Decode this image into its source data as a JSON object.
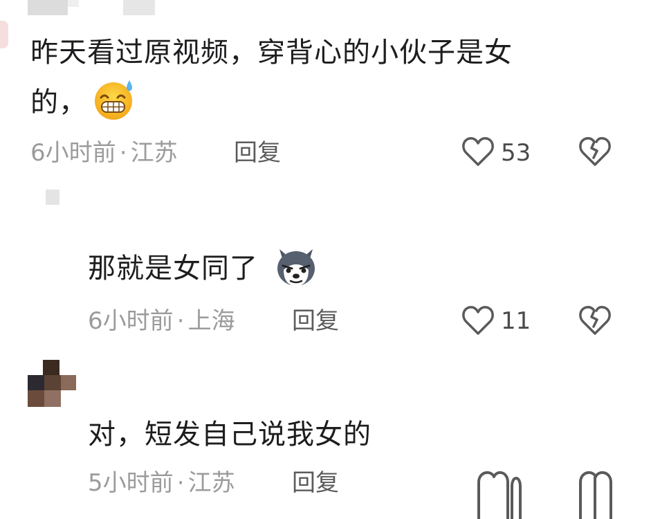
{
  "comments": [
    {
      "line1": "昨天看过原视频，穿背心的小伙子是女",
      "line2": "的，",
      "emoji": "grinning-sweat-emoji",
      "time": "6小时前",
      "location": "江苏",
      "reply_label": "回复",
      "likes": "53"
    },
    {
      "text": "那就是女同了",
      "emoji": "husky-dog-emoji",
      "time": "6小时前",
      "location": "上海",
      "reply_label": "回复",
      "likes": "11"
    },
    {
      "text": "对，短发自己说我女的",
      "time": "5小时前",
      "location": "江苏",
      "reply_label": "回复"
    }
  ],
  "separator": "·",
  "colors": {
    "text": "#1d1d1f",
    "meta": "#9b9b9b",
    "icon": "#5a5a5a"
  }
}
